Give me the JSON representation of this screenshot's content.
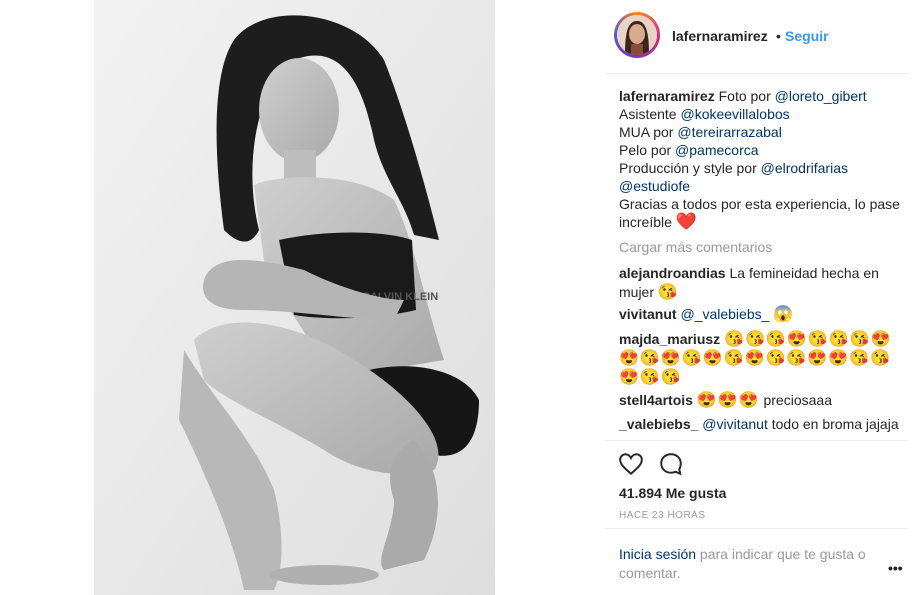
{
  "post": {
    "photo_alt": "black-and-white photo of a woman crouching",
    "photo_text": "CALVIN KLEIN"
  },
  "header": {
    "username": "lafernaramirez",
    "separator": "•",
    "follow_label": "Seguir"
  },
  "caption": {
    "username": "lafernaramirez",
    "lines": [
      {
        "text": " Foto por ",
        "mention": "@loreto_gibert"
      },
      {
        "text": "Asistente ",
        "mention": "@kokeevillalobos"
      },
      {
        "text": "MUA por ",
        "mention": "@tereirarrazabal"
      },
      {
        "text": "Pelo por ",
        "mention": "@pamecorca"
      },
      {
        "text": "Producción y style por ",
        "mention": "@elrodrifarias"
      },
      {
        "text": "",
        "mention": "@estudiofe"
      }
    ],
    "thanks": "Gracias a todos por esta experiencia, lo pase increíble",
    "heart": "❤️"
  },
  "load_more": "Cargar más comentarios",
  "comments": [
    {
      "user": "alejandroandias",
      "text": "La femineidad hecha en mujer",
      "emoji": "😘"
    },
    {
      "user": "vivitanut",
      "mention": "@_valebiebs_",
      "emoji": "😱"
    },
    {
      "user": "majda_mariusz",
      "emoji": "😘😘😘😍😘😘😘😍😍😘😍😘😍😘😍😘😘😍😍😘😘😍😘😘"
    },
    {
      "user": "stell4artois",
      "emoji": "😍😍😍",
      "text": "preciosaaa"
    },
    {
      "user": "_valebiebs_",
      "mention": "@vivitanut",
      "text": "todo en broma jajaja"
    }
  ],
  "likes_text": "41.894 Me gusta",
  "time_text": "HACE 23 HORAS",
  "login": {
    "link": "Inicia sesión",
    "rest": " para indicar que te gusta o comentar."
  },
  "more_label": "•••",
  "icons": [
    "heart-outline-icon",
    "comment-bubble-icon",
    "more-options-icon"
  ]
}
